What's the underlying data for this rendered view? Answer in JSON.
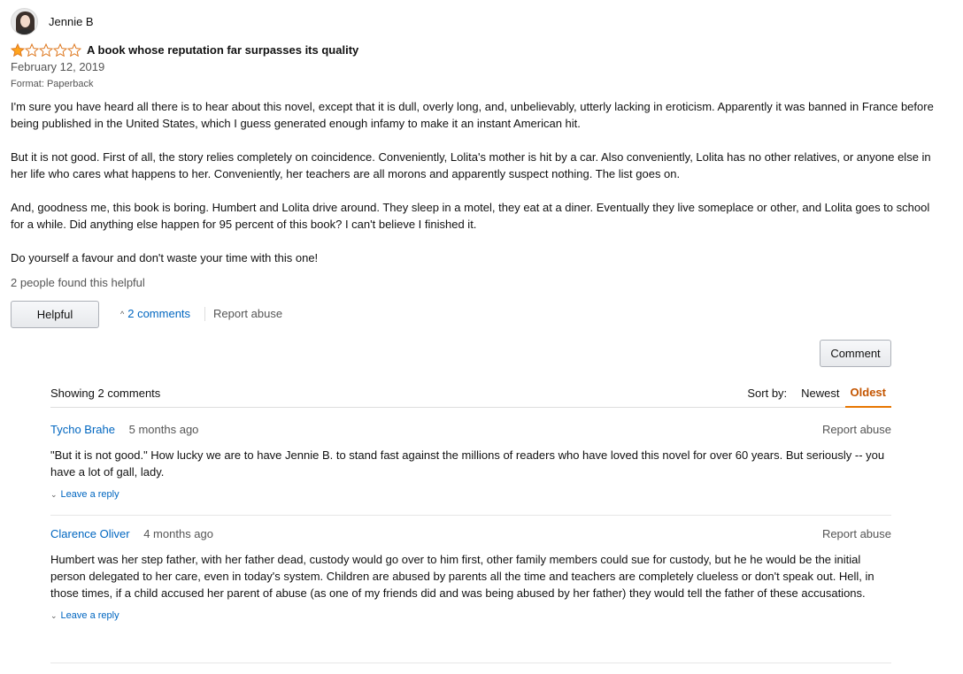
{
  "review": {
    "reviewer_name": "Jennie B",
    "rating": 1,
    "max_rating": 5,
    "title": "A book whose reputation far surpasses its quality",
    "date": "February 12, 2019",
    "format": "Format: Paperback",
    "paragraphs": [
      "I'm sure you have heard all there is to hear about this novel, except that it is dull, overly long, and, unbelievably, utterly lacking in eroticism. Apparently it was banned in France before being published in the United States, which I guess generated enough infamy to make it an instant American hit.",
      "But it is not good. First of all, the story relies completely on coincidence. Conveniently, Lolita's mother is hit by a car. Also conveniently, Lolita has no other relatives, or anyone else in her life who cares what happens to her. Conveniently, her teachers are all morons and apparently suspect nothing. The list goes on.",
      "And, goodness me, this book is boring. Humbert and Lolita drive around. They sleep in a motel, they eat at a diner. Eventually they live someplace or other, and Lolita goes to school for a while. Did anything else happen for 95 percent of this book? I can't believe I finished it.",
      "Do yourself a favour and don't waste your time with this one!"
    ],
    "helpful_count_text": "2 people found this helpful",
    "helpful_button": "Helpful",
    "comments_link": "2 comments",
    "report_abuse": "Report abuse",
    "star_color": "#ffa41c"
  },
  "comment_button": "Comment",
  "comments": {
    "showing_text": "Showing 2 comments",
    "sort_label": "Sort by:",
    "sort_options": [
      "Newest",
      "Oldest"
    ],
    "active_sort": "Oldest",
    "items": [
      {
        "author": "Tycho Brahe",
        "time": "5 months ago",
        "report": "Report abuse",
        "text": "\"But it is not good.\" How lucky we are to have Jennie B. to stand fast against the millions of readers who have loved this novel for over 60 years. But seriously -- you have a lot of gall, lady.",
        "reply": "Leave a reply"
      },
      {
        "author": "Clarence Oliver",
        "time": "4 months ago",
        "report": "Report abuse",
        "text": "Humbert was her step father, with her father dead, custody would go over to him first, other family members could sue for custody, but he he would be the initial person delegated to her care, even in today's system. Children are abused by parents all the time and teachers are completely clueless or don't speak out. Hell, in those times, if a child accused her parent of abuse (as one of my friends did and was being abused by her father) they would tell the father of these accusations.",
        "reply": "Leave a reply"
      }
    ]
  }
}
